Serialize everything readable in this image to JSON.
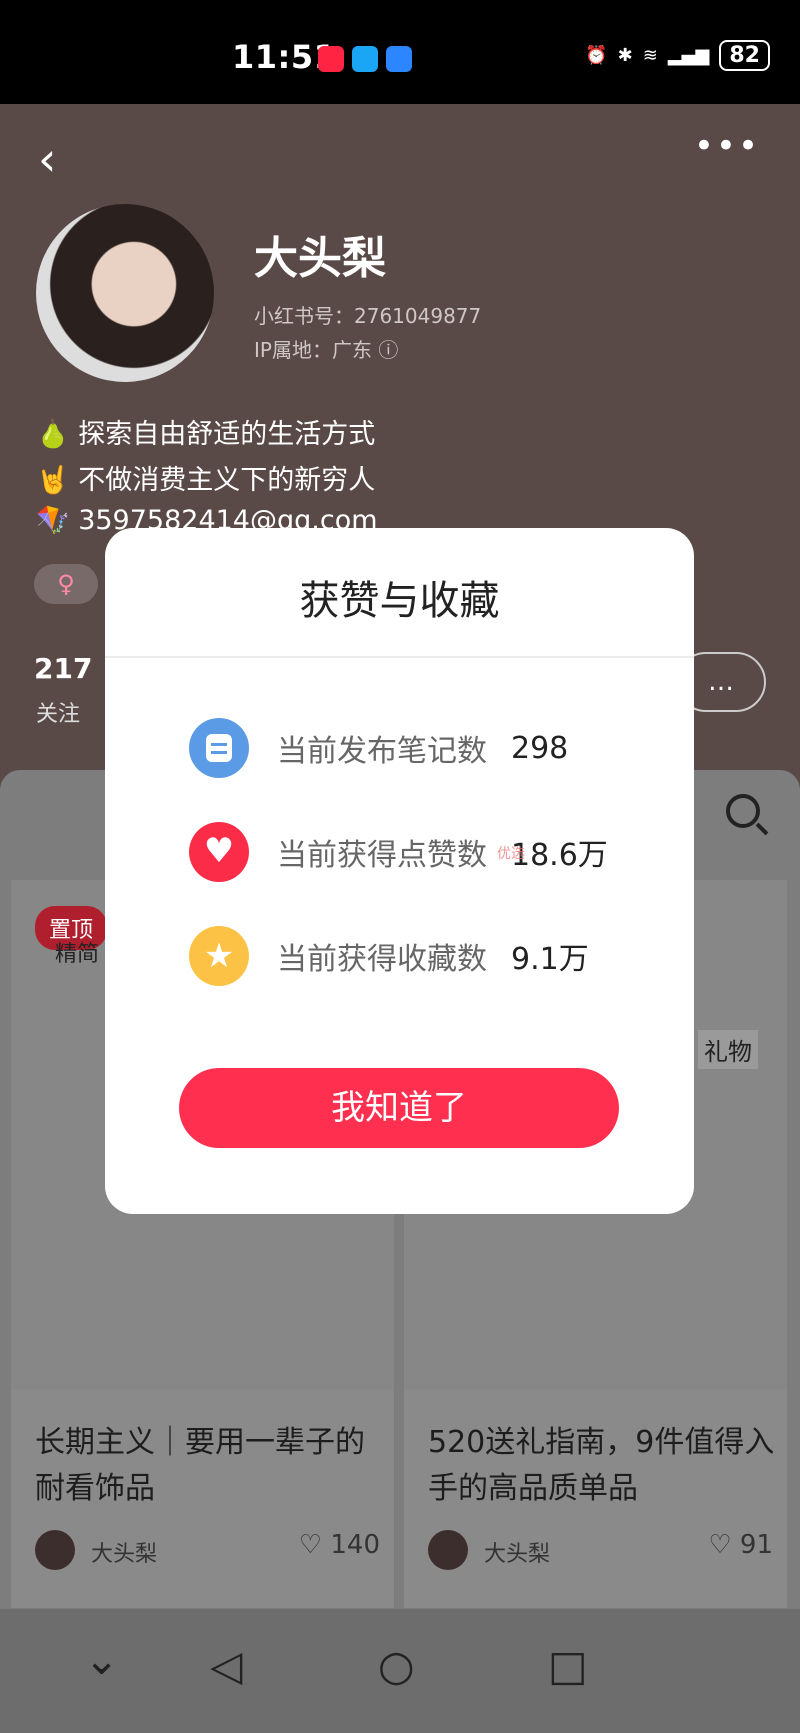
{
  "status": {
    "time": "11:51",
    "battery": "82"
  },
  "profile": {
    "name": "大头梨",
    "id_text": "小红书号：2761049877",
    "ip_text": "IP属地：广东 ⓘ",
    "bio": [
      "🍐 探索自由舒适的生活方式",
      "🤘 不做消费主义下的新穷人",
      "🪁 3597582414@qq.com"
    ],
    "sex_tag": "♀",
    "follow_count": "217",
    "follow_label": "关注"
  },
  "feed": {
    "pinned_label": "置顶",
    "pinned_partial": "精简",
    "gift_label": "礼物",
    "cards": [
      {
        "title": "长期主义｜要用一辈子的耐看饰品",
        "author": "大头梨",
        "likes": "140"
      },
      {
        "title": "520送礼指南，9件值得入手的高品质单品",
        "author": "大头梨",
        "likes": "91"
      }
    ]
  },
  "modal": {
    "title": "获赞与收藏",
    "rows": [
      {
        "label": "当前发布笔记数",
        "value": "298",
        "icon": "note-icon",
        "color": "#5b9be6"
      },
      {
        "label": "当前获得点赞数",
        "value": "18.6万",
        "icon": "heart-icon",
        "color": "#fb2c48"
      },
      {
        "label": "当前获得收藏数",
        "value": "9.1万",
        "icon": "star-icon",
        "color": "#fcc246"
      }
    ],
    "watermark": "优选",
    "button": "我知道了"
  }
}
